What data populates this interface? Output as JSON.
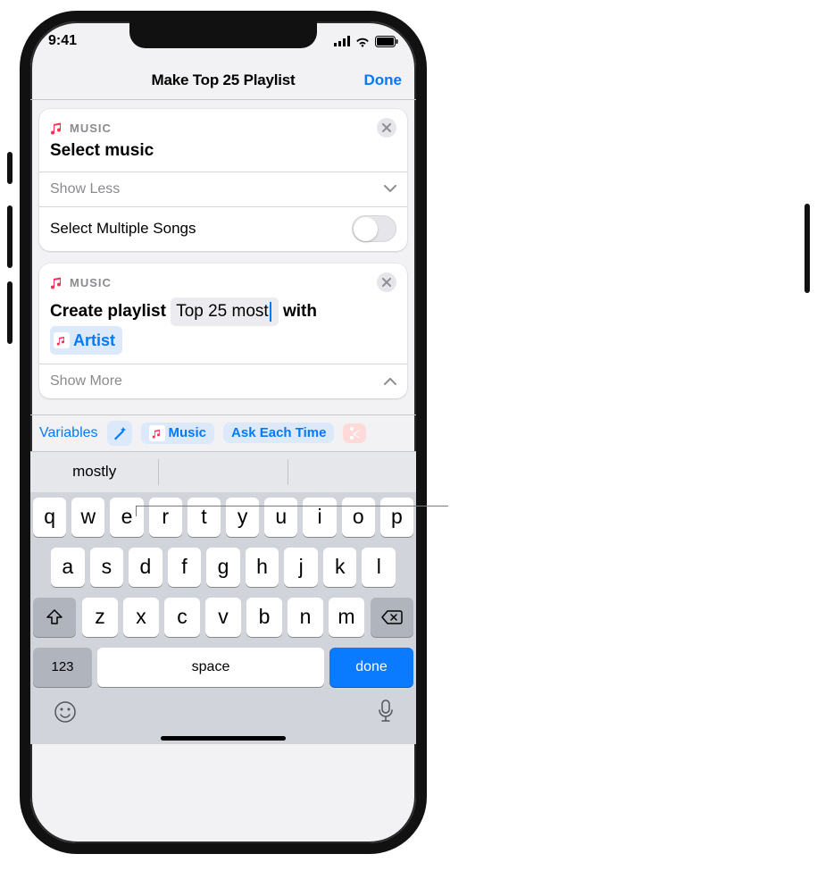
{
  "status": {
    "time": "9:41"
  },
  "nav": {
    "title": "Make Top 25 Playlist",
    "done": "Done"
  },
  "card1": {
    "app": "MUSIC",
    "title": "Select music",
    "showless": "Show Less",
    "multi": "Select Multiple Songs"
  },
  "card2": {
    "app": "MUSIC",
    "t1": "Create playlist",
    "field": "Top 25 most",
    "t2": "with",
    "var": "Artist",
    "showmore": "Show More"
  },
  "varbar": {
    "label": "Variables",
    "music": "Music",
    "ask": "Ask Each Time"
  },
  "suggest": {
    "s1": "mostly"
  },
  "keys": {
    "r1": [
      "q",
      "w",
      "e",
      "r",
      "t",
      "y",
      "u",
      "i",
      "o",
      "p"
    ],
    "r2": [
      "a",
      "s",
      "d",
      "f",
      "g",
      "h",
      "j",
      "k",
      "l"
    ],
    "r3": [
      "z",
      "x",
      "c",
      "v",
      "b",
      "n",
      "m"
    ],
    "num": "123",
    "space": "space",
    "done": "done"
  }
}
